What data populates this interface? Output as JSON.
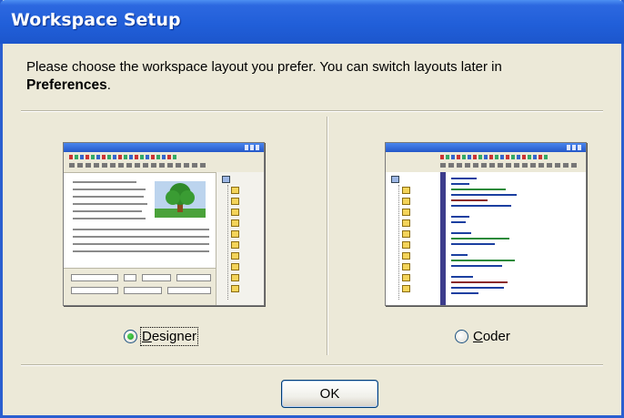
{
  "window": {
    "title": "Workspace Setup"
  },
  "prompt": {
    "text": "Please choose the workspace layout you prefer. You can switch layouts later in",
    "emphasis": "Preferences",
    "suffix": "."
  },
  "options": [
    {
      "id": "designer",
      "accel": "D",
      "rest": "esigner",
      "selected": true
    },
    {
      "id": "coder",
      "accel": "C",
      "rest": "oder",
      "selected": false
    }
  ],
  "buttons": {
    "ok_label": "OK"
  },
  "colors": {
    "titlebar": "#215fd9",
    "dialog_bg": "#ece9d8",
    "radio_check": "#21a121"
  }
}
